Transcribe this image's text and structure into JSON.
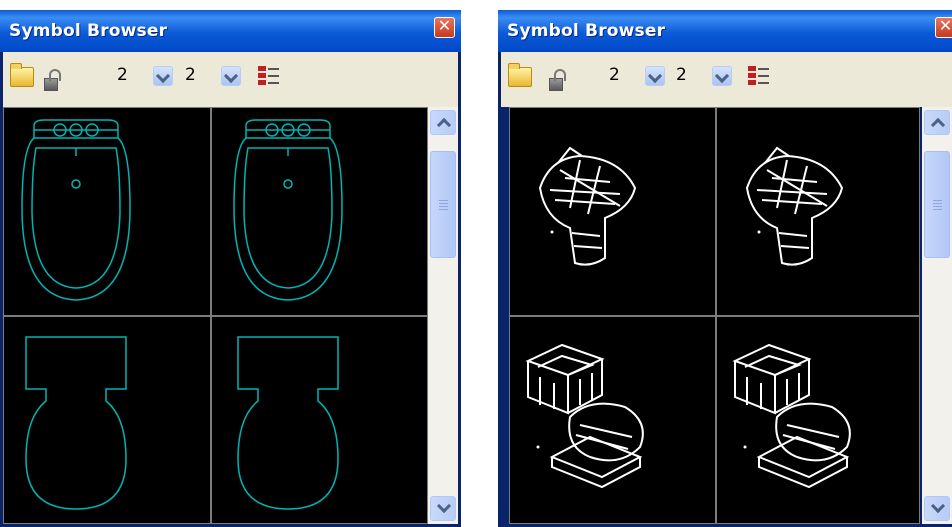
{
  "windows": [
    {
      "title": "Symbol Browser",
      "rows_select": "2",
      "cols_select": "2",
      "style": "wireframe",
      "symbols": [
        "bidet-plan-view",
        "bidet-plan-view-mirror",
        "toilet-plan-view",
        "toilet-plan-view-mirror"
      ]
    },
    {
      "title": "Symbol Browser",
      "rows_select": "2",
      "cols_select": "2",
      "style": "3d",
      "symbols": [
        "bidet-3d-view",
        "bidet-3d-view-mirror",
        "toilet-3d-view",
        "toilet-3d-view-mirror"
      ]
    }
  ],
  "colors": {
    "titlebar": "#0c5ad8",
    "frame": "#0a246a",
    "toolbar_bg": "#ece9d8",
    "preview_bg": "#000000",
    "wireframe_stroke": "#00b4b4",
    "render_stroke": "#ffffff",
    "close_button": "#d6512f"
  },
  "icons": [
    "folder-icon",
    "lock-icon",
    "chevron-down-icon",
    "list-options-icon",
    "close-icon",
    "scroll-up-icon",
    "scroll-down-icon"
  ]
}
